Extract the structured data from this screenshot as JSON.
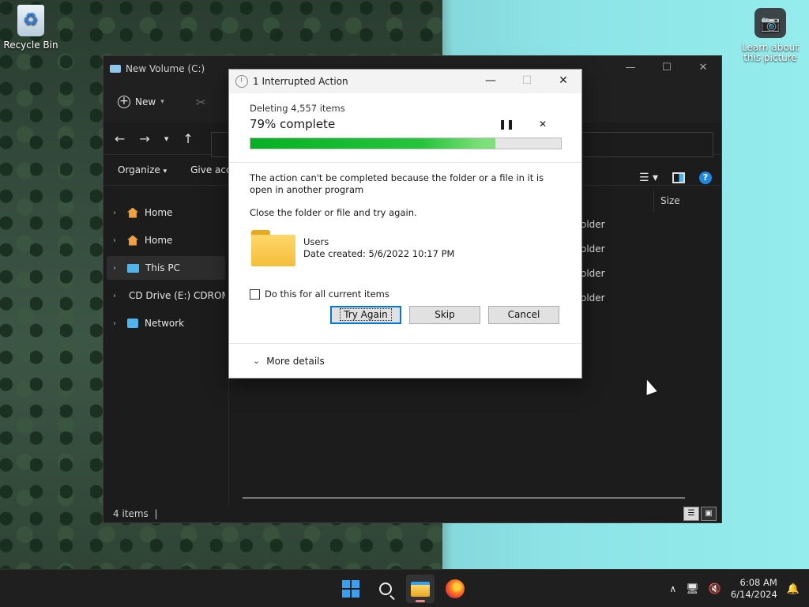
{
  "desktop": {
    "recycle_bin_label": "Recycle Bin",
    "learn_label": "Learn about this picture"
  },
  "explorer": {
    "title": "New Volume (C:)",
    "toolbar": {
      "new_label": "New"
    },
    "command_bar": {
      "organize_label": "Organize",
      "give_access_label": "Give acce"
    },
    "sidebar": {
      "items": [
        {
          "label": "Home",
          "icon": "home-icon"
        },
        {
          "label": "Home",
          "icon": "home-icon"
        },
        {
          "label": "This PC",
          "icon": "pc-icon",
          "selected": true
        },
        {
          "label": "CD Drive (E:) CDROM",
          "icon": "cd-drive-icon"
        },
        {
          "label": "Network",
          "icon": "network-icon"
        }
      ]
    },
    "column_header_size": "Size",
    "rows": [
      "older",
      "older",
      "older",
      "older"
    ],
    "status_items": "4 items"
  },
  "dialog": {
    "title": "1 Interrupted Action",
    "deleting_text": "Deleting 4,557 items",
    "percent_text": "79% complete",
    "progress_fraction": 0.79,
    "message": "The action can't be completed because the folder or a file in it is open in another program",
    "instruction": "Close the folder or file and try again.",
    "item_name": "Users",
    "item_date": "Date created: 5/6/2022 10:17 PM",
    "checkbox_label": "Do this for all current items",
    "try_again_label": "Try Again",
    "skip_label": "Skip",
    "cancel_label": "Cancel",
    "more_details_label": "More details"
  },
  "taskbar": {
    "time": "6:08 AM",
    "date": "6/14/2024"
  },
  "colors": {
    "progress_green": "#06b025",
    "accent_blue": "#0078d7"
  }
}
